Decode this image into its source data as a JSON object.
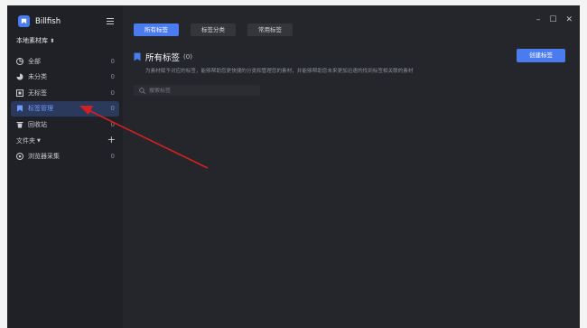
{
  "app": {
    "name": "Billfish"
  },
  "sidebar": {
    "library_label": "本地素材库",
    "items": [
      {
        "label": "全部",
        "count": "0",
        "icon": "grid-icon"
      },
      {
        "label": "未分类",
        "count": "0",
        "icon": "pie-icon"
      },
      {
        "label": "无标签",
        "count": "0",
        "icon": "tag-off-icon"
      },
      {
        "label": "标签管理",
        "count": "0",
        "icon": "tag-manage-icon",
        "active": true
      },
      {
        "label": "回收站",
        "count": "0",
        "icon": "trash-icon"
      }
    ],
    "folders_label": "文件夹",
    "folder_items": [
      {
        "label": "浏览器采集",
        "count": "0",
        "icon": "browser-icon"
      }
    ]
  },
  "main": {
    "tabs": [
      {
        "label": "所有标签",
        "active": true
      },
      {
        "label": "标签分类",
        "active": false
      },
      {
        "label": "常用标签",
        "active": false
      }
    ],
    "title": "所有标签",
    "title_count": "(0)",
    "description": "为素材赋予对应的标签，能够帮助您更快捷的分类和管理您的素材，并能够帮助您未来更加迅速的找到标签相关联的素材",
    "create_button": "创建标签",
    "search_placeholder": "搜索标签"
  },
  "colors": {
    "accent": "#4a7cf0",
    "sidebar_bg": "#1f2126",
    "main_bg": "#24262b",
    "annotation_arrow": "#d42020"
  }
}
